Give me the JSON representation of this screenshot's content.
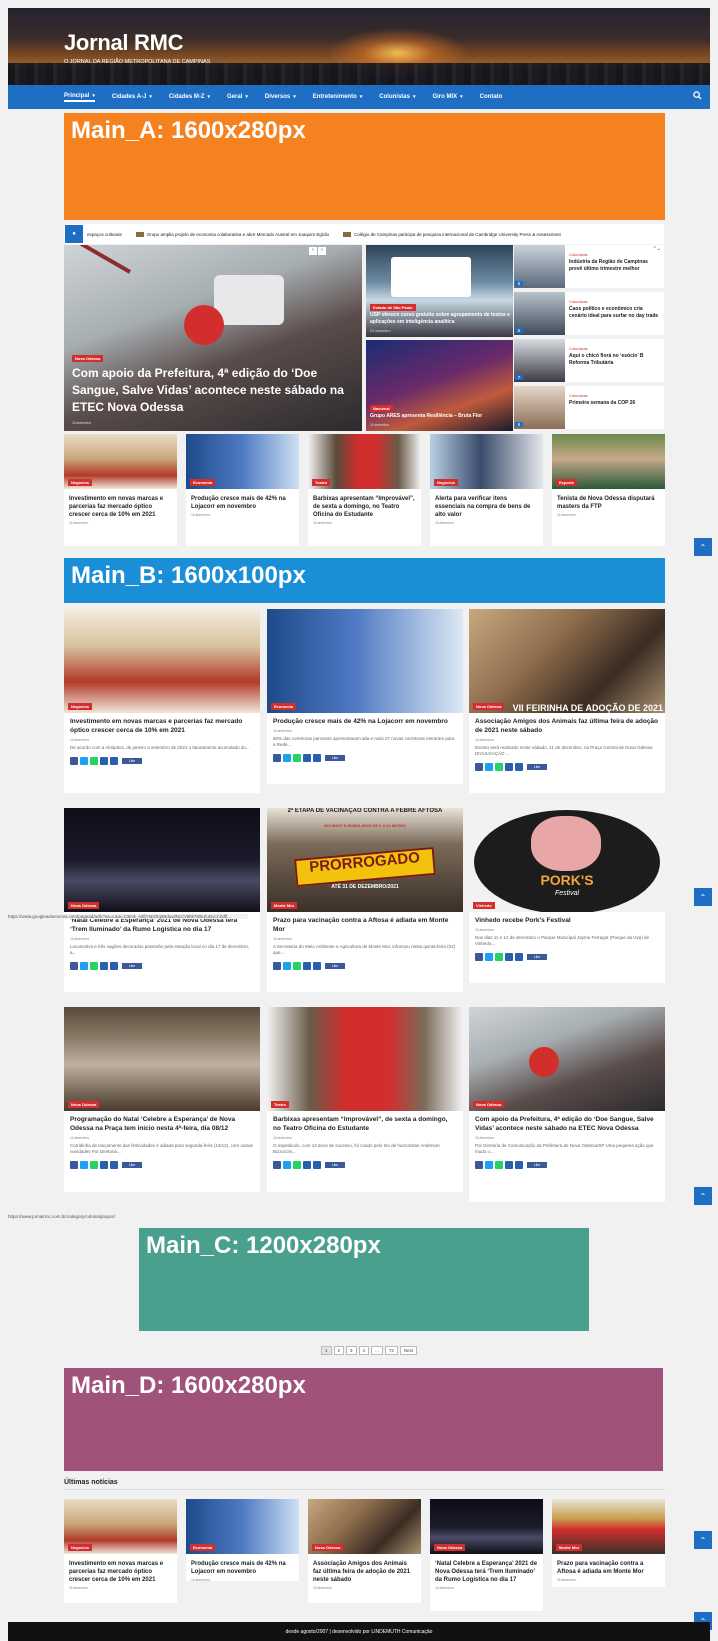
{
  "site": {
    "title": "Jornal RMC",
    "tagline": "O JORNAL DA REGIÃO METROPOLITANA DE CAMPINAS"
  },
  "nav": {
    "items": [
      {
        "label": "Principal",
        "has_menu": true,
        "active": true
      },
      {
        "label": "Cidades A-J",
        "has_menu": true
      },
      {
        "label": "Cidades M-Z",
        "has_menu": true
      },
      {
        "label": "Geral",
        "has_menu": true
      },
      {
        "label": "Diversos",
        "has_menu": true
      },
      {
        "label": "Entretenimento",
        "has_menu": true
      },
      {
        "label": "Colunistas",
        "has_menu": true
      },
      {
        "label": "Giro MIX",
        "has_menu": true
      },
      {
        "label": "Contato",
        "has_menu": false
      }
    ]
  },
  "ads": {
    "main_a": "Main_A: 1600x280px",
    "main_b": "Main_B: 1600x100px",
    "main_c": "Main_C: 1200x280px",
    "main_d": "Main_D: 1600x280px"
  },
  "ad_colors": {
    "main_a": "#f5821f",
    "main_b": "#1a8fd8",
    "main_c": "#4aa08e",
    "main_d": "#a0527a"
  },
  "ticker": {
    "items": [
      "espaços culturais",
      "Grupo amplia projeto de economia colaborativa e abre Mercado Autoral em Joaquim Egídio",
      "Colégio de Campinas participa de pesquisa internacional da Cambridge University Press & Assessment"
    ]
  },
  "hero": {
    "category": "Nova Odessa",
    "title": "Com apoio da Prefeitura, 4ª edição do ‘Doe Sangue, Salve Vidas’ acontece neste sábado na ETEC Nova Odessa",
    "date": "11dezembro"
  },
  "mid_features": [
    {
      "category": "Estado de São Paulo",
      "title": "USP oferece curso gratuito sobre agrupamento de textos e aplicações em inteligência analítica",
      "date": "24 novembro"
    },
    {
      "category": "Nacional",
      "title": "Grupo ARES apresenta Resiliência – Bruta Flor",
      "date": "11novembro"
    }
  ],
  "side_list": [
    {
      "num": "5",
      "category": "Colunistas",
      "title": "Indústria da Região de Campinas prevê último trimestre melhor"
    },
    {
      "num": "6",
      "category": "Colunistas",
      "title": "Caos político e econômico cria cenário ideal para surfar no day trade"
    },
    {
      "num": "7",
      "category": "Colunistas",
      "title": "Aqui o chicó florá no ‘esócio’ B Reforma Tributária"
    },
    {
      "num": "8",
      "category": "Colunistas",
      "title": "Primeira semana da COP 26"
    }
  ],
  "row5": [
    {
      "category": "Negócios",
      "title": "Investimento em novas marcas e parcerias faz mercado óptico crescer cerca de 10% em 2021",
      "date": "11dezembro"
    },
    {
      "category": "Economia",
      "title": "Produção cresce mais de 42% na Lojacorr em novembro",
      "date": "11dezembro"
    },
    {
      "category": "Teatro",
      "title": "Barbixas apresentam “Improvável”, de sexta a domingo, no Teatro Oficina do Estudante",
      "date": "11dezembro"
    },
    {
      "category": "Negócios",
      "title": "Alerta para verificar itens essenciais na compra de bens de alto valor",
      "date": "11dezembro"
    },
    {
      "category": "Esporte",
      "title": "Tenista de Nova Odessa disputará masters da FTP",
      "date": "11dezembro"
    }
  ],
  "grid": [
    {
      "category": "Negócios",
      "title": "Investimento em novas marcas e parcerias faz mercado óptico crescer cerca de 10% em 2021",
      "date": "11dezembro",
      "excerpt": "De acordo com a Abióptica, de janeiro a setembro de 2021 o faturamento acumulado do..."
    },
    {
      "category": "Economia",
      "title": "Produção cresce mais de 42% na Lojacorr em novembro",
      "date": "11dezembro",
      "excerpt": "90% das corretoras parceiras apresentaram alta e mais 27 novas corretoras entraram para a Rede..."
    },
    {
      "category": "Nova Odessa",
      "title": "Associação Amigos dos Animais faz última feira de adoção de 2021 neste sábado",
      "date": "11dezembro",
      "excerpt": "Evento será realizado neste sábado, 11 de dezembro, na Praça Central de Nova Odessa DIVULGAÇÃO ..."
    },
    {
      "category": "Nova Odessa",
      "title": "‘Natal Celebre a Esperança’ 2021 de Nova Odessa terá ‘Trem Iluminado’ da Rumo Logística no dia 17",
      "date": "11dezembro",
      "excerpt": "Locomotiva e três vagões decorados passarão pela estação local no dia 17 de dezembro, a..."
    },
    {
      "category": "Monte Mor",
      "title": "Prazo para vacinação contra a Aftosa é adiada em Monte Mor",
      "date": "11dezembro",
      "excerpt": "A Secretaria do Meio Ambiente e Agricultura de Monte Mor, informou nesta quinta-feira (02) que..."
    },
    {
      "category": "Vinhedo",
      "title": "Vinhedo recebe Pork’s Festival",
      "date": "11dezembro",
      "excerpt": "Nos dias 11 e 12 de dezembro o Parque Municipal Jayme Ferragut (Parque da Uva) de Vinhedo..."
    },
    {
      "category": "Nova Odessa",
      "title": "Programação do Natal ‘Celebre a Esperança’ de Nova Odessa na Praça tem início nesta 4ª-feira, dia 08/12",
      "date": "11dezembro",
      "excerpt": "Corridinha de lançamento das festividades é adiada para segunda-feira (13/12), com outras novidades Por Diretoria..."
    },
    {
      "category": "Teatro",
      "title": "Barbixas apresentam “Improvável”, de sexta a domingo, no Teatro Oficina do Estudante",
      "date": "11dezembro",
      "excerpt": "O espetáculo, com 14 anos de sucesso, foi criado pelo trio de humoristas Anderson Bizzocchi..."
    },
    {
      "category": "Nova Odessa",
      "title": "Com apoio da Prefeitura, 4ª edição do ‘Doe Sangue, Salve Vidas’ acontece neste sábado na ETEC Nova Odessa",
      "date": "11dezembro",
      "excerpt": "Por Diretoria de Comunicação da Prefeitura de Nova Odessa/SP Uma pequena ação que mudo o..."
    }
  ],
  "image_overlays": {
    "feira": "VII FEIRINHA DE ADOÇÃO DE 2021",
    "aftosa_top": "2ª ETAPA DE VACINAÇÃO CONTRA A FEBRE AFTOSA",
    "aftosa_sub": "BOVINOS E BUBALINOS DE 0 A 24 MESES",
    "prorrogado": "PRORROGADO",
    "prorrogado_sub": "ATÉ 31 DE DEZEMBRO/2021",
    "porks": "PORK'S",
    "porks_sub": "Festival"
  },
  "like_label": "Like",
  "status_urls": {
    "first": "https://www.googleadservices.com/pagead/aclk?sa=L&ai=CBHk_edfjYtaIOIq5BduwlNcCv9ttk7t0leZuDvcC0dfl...",
    "second": "https://www.jornalrmc.com.br/category/coluna/grupos/"
  },
  "pagination": [
    "1",
    "2",
    "3",
    "4",
    "...",
    "72",
    "Next"
  ],
  "latest": {
    "heading": "Últimas notícias",
    "items": [
      {
        "category": "Negócios",
        "title": "Investimento em novas marcas e parcerias faz mercado óptico crescer cerca de 10% em 2021",
        "date": "11dezembro"
      },
      {
        "category": "Economia",
        "title": "Produção cresce mais de 42% na Lojacorr em novembro",
        "date": "11dezembro"
      },
      {
        "category": "Nova Odessa",
        "title": "Associação Amigos dos Animais faz última feira de adoção de 2021 neste sábado",
        "date": "11dezembro"
      },
      {
        "category": "Nova Odessa",
        "title": "‘Natal Celebre a Esperança’ 2021 de Nova Odessa terá ‘Trem Iluminado’ da Rumo Logística no dia 17",
        "date": "11dezembro"
      },
      {
        "category": "Monte Mor",
        "title": "Prazo para vacinação contra a Aftosa é adiada em Monte Mor",
        "date": "11dezembro"
      }
    ]
  },
  "footer": "desde agosto/2007 | desenvolvido por LINDEMUTH Comunicação",
  "colors": {
    "brand_blue": "#1e6fc4",
    "category_red": "#d32e2e"
  },
  "icons": {
    "search": "search-icon",
    "scroll_top": "chevron-up-icon"
  }
}
